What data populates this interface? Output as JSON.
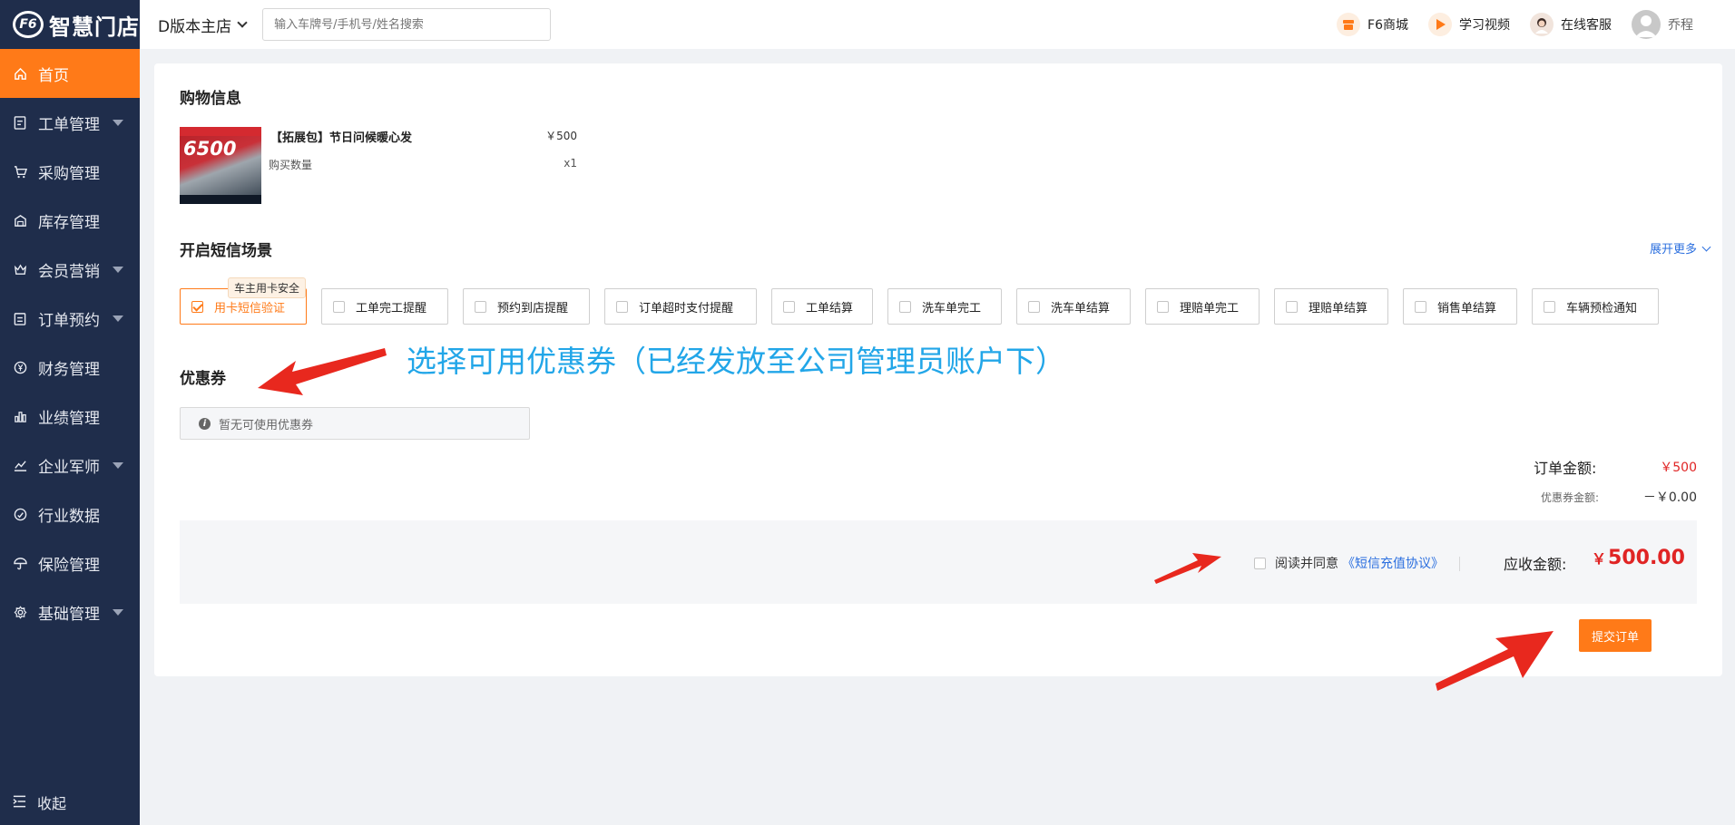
{
  "brand": {
    "logo_text": "智慧门店",
    "logo_mark": "F6"
  },
  "sidebar": {
    "items": [
      {
        "label": "首页",
        "icon": "home-icon"
      },
      {
        "label": "工单管理",
        "icon": "clipboard-icon"
      },
      {
        "label": "采购管理",
        "icon": "cart-icon"
      },
      {
        "label": "库存管理",
        "icon": "warehouse-icon"
      },
      {
        "label": "会员营销",
        "icon": "crown-icon"
      },
      {
        "label": "订单预约",
        "icon": "calendar-icon"
      },
      {
        "label": "财务管理",
        "icon": "yen-icon"
      },
      {
        "label": "业绩管理",
        "icon": "bar-chart-icon"
      },
      {
        "label": "企业军师",
        "icon": "trend-icon"
      },
      {
        "label": "行业数据",
        "icon": "gauge-icon"
      },
      {
        "label": "保险管理",
        "icon": "umbrella-icon"
      },
      {
        "label": "基础管理",
        "icon": "gear-icon"
      }
    ],
    "collapse_label": "收起"
  },
  "topbar": {
    "store_name": "D版本主店",
    "search_placeholder": "输入车牌号/手机号/姓名搜索",
    "mall": "F6商城",
    "video": "学习视频",
    "service": "在线客服",
    "user": "乔程"
  },
  "shopping": {
    "title": "购物信息",
    "image_text": "6500",
    "product_name": "【拓展包】节日问候暖心发",
    "price": "￥500",
    "qty_label": "购买数量",
    "qty": "x1"
  },
  "sms": {
    "title": "开启短信场景",
    "expand": "展开更多",
    "scenes": [
      {
        "label": "用卡短信验证",
        "checked": true,
        "tag": "车主用卡安全"
      },
      {
        "label": "工单完工提醒",
        "checked": false
      },
      {
        "label": "预约到店提醒",
        "checked": false
      },
      {
        "label": "订单超时支付提醒",
        "checked": false
      },
      {
        "label": "工单结算",
        "checked": false
      },
      {
        "label": "洗车单完工",
        "checked": false
      },
      {
        "label": "洗车单结算",
        "checked": false
      },
      {
        "label": "理赔单完工",
        "checked": false
      },
      {
        "label": "理赔单结算",
        "checked": false
      },
      {
        "label": "销售单结算",
        "checked": false
      },
      {
        "label": "车辆预检通知",
        "checked": false
      }
    ]
  },
  "annotation": "选择可用优惠券（已经发放至公司管理员账户下）",
  "coupon": {
    "title": "优惠券",
    "empty_text": "暂无可使用优惠券"
  },
  "amounts": {
    "order_label": "订单金额:",
    "order_value": "￥500",
    "coupon_label": "优惠券金额:",
    "coupon_value": "－￥0.00"
  },
  "payment": {
    "agree_text": "阅读并同意",
    "agreement_link": "《短信充值协议》",
    "receivable_label": "应收金额:",
    "receivable_currency": "￥",
    "receivable_value": "500.00",
    "submit_label": "提交订单"
  },
  "colors": {
    "sidebar_bg": "#1f2d4b",
    "accent": "#ff7a18",
    "price_red": "#e02424",
    "link_blue": "#2b6fdf",
    "annotation_blue": "#22a6e8",
    "arrow_red": "#e8281e"
  }
}
